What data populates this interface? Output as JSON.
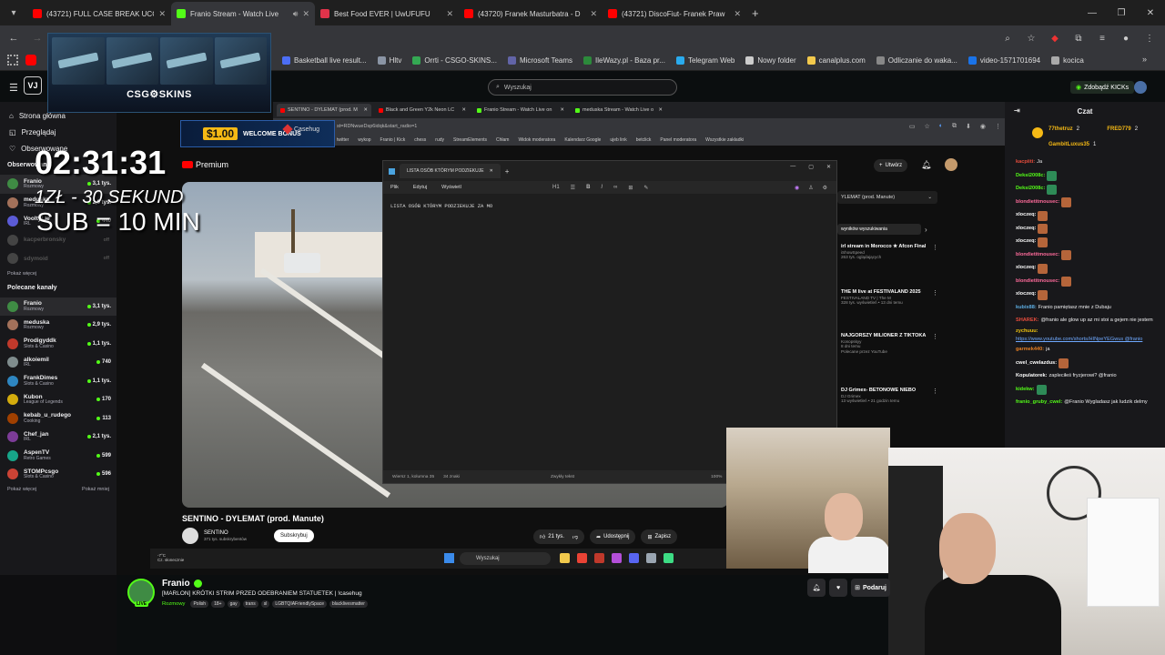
{
  "browser": {
    "tabs": [
      {
        "label": "(43721) FULL CASE BREAK UCCO",
        "icon": "youtube-icon",
        "color": "#ff0000",
        "active": false
      },
      {
        "label": "Franio Stream - Watch Live",
        "icon": "kick-icon",
        "color": "#53fc18",
        "active": true
      },
      {
        "label": "Best Food EVER | UwUFUFU",
        "icon": "uwufufu-icon",
        "color": "#e0334a",
        "active": false
      },
      {
        "label": "(43720) Franek Masturbatra - D",
        "icon": "youtube-icon",
        "color": "#ff0000",
        "active": false
      },
      {
        "label": "(43721) DiscoFiut- Franek Praw",
        "icon": "youtube-icon",
        "color": "#ff0000",
        "active": false
      }
    ],
    "bookmarks": [
      {
        "label": "Basketball live result...",
        "color": "#4c6ef5"
      },
      {
        "label": "Hltv",
        "color": "#8b95a5"
      },
      {
        "label": "Orrti - CSGO-SKINS...",
        "color": "#34a853"
      },
      {
        "label": "Microsoft Teams",
        "color": "#6264a7"
      },
      {
        "label": "IleWazy.pl - Baza pr...",
        "color": "#2c8a3b"
      },
      {
        "label": "Telegram Web",
        "color": "#2aabee"
      },
      {
        "label": "Nowy folder",
        "color": "#cccccc"
      },
      {
        "label": "canalplus.com",
        "color": "#f2c94c"
      },
      {
        "label": "Odliczanie do waka...",
        "color": "#888888"
      },
      {
        "label": "video-1571701694",
        "color": "#1a73e8"
      },
      {
        "label": "kocica",
        "color": "#aaaaaa"
      }
    ]
  },
  "kick": {
    "search_placeholder": "Wyszukaj",
    "get_kicks": "Zdobądź KICKs",
    "logo_text": "VJ"
  },
  "sidebar": {
    "nav": [
      "Strona główna",
      "Przeglądaj",
      "Obserwowane"
    ],
    "followed_header": "Obserwowane",
    "followed": [
      {
        "name": "Franio",
        "cat": "Rozmowy",
        "viewers": "3,1 tys.",
        "color": "#3f8b44",
        "selected": true,
        "dim": false
      },
      {
        "name": "meduska",
        "cat": "Rozmowy",
        "viewers": "2,9 tys.",
        "color": "#a3715a",
        "selected": false,
        "dim": false
      },
      {
        "name": "VooltyLie",
        "cat": "IRL",
        "viewers": "440",
        "color": "#5b5bd6",
        "selected": false,
        "dim": false
      },
      {
        "name": "kacperbronsky",
        "cat": "",
        "viewers": "",
        "color": "#444444",
        "selected": false,
        "dim": true
      },
      {
        "name": "sdymoid",
        "cat": "",
        "viewers": "",
        "color": "#444444",
        "selected": false,
        "dim": true
      }
    ],
    "show_more": "Pokaż więcej",
    "recommended_header": "Polecane kanały",
    "recommended": [
      {
        "name": "Franio",
        "cat": "Rozmowy",
        "viewers": "3,1 tys.",
        "color": "#3f8b44",
        "selected": true
      },
      {
        "name": "meduska",
        "cat": "Rozmowy",
        "viewers": "2,9 tys.",
        "color": "#a3715a",
        "selected": false
      },
      {
        "name": "Prodigyddk",
        "cat": "Slots & Casino",
        "viewers": "1,1 tys.",
        "color": "#c0392b",
        "selected": false
      },
      {
        "name": "alkoiemil",
        "cat": "IRL",
        "viewers": "740",
        "color": "#7f8c8d",
        "selected": false
      },
      {
        "name": "FrankDimes",
        "cat": "Slots & Casino",
        "viewers": "1,1 tys.",
        "color": "#2e86c1",
        "selected": false
      },
      {
        "name": "Kubon",
        "cat": "League of Legends",
        "viewers": "170",
        "color": "#d4ac0d",
        "selected": false
      },
      {
        "name": "kebab_u_rudego",
        "cat": "Cooking",
        "viewers": "113",
        "color": "#a04000",
        "selected": false
      },
      {
        "name": "Chef_jan",
        "cat": "IRL",
        "viewers": "2,1 tys.",
        "color": "#7d3c98",
        "selected": false
      },
      {
        "name": "AspenTV",
        "cat": "Retro Games",
        "viewers": "599",
        "color": "#17a589",
        "selected": false
      },
      {
        "name": "STOMPcsgo",
        "cat": "Slots & Casino",
        "viewers": "596",
        "color": "#cb4335",
        "selected": false
      }
    ],
    "show_more2": "Pokaż więcej",
    "show_less": "Pokaż mniej"
  },
  "overlay": {
    "csgo_logo": "CSG⚙SKINS",
    "timer": "02:31:31",
    "rate_line": "1ZŁ - 30 SEKUND",
    "sub_line": "SUB = 10 MIN",
    "welcome_amount": "$1.00",
    "welcome_text": "WELCOME BONUS",
    "casehug": "Casehug"
  },
  "inner_browser": {
    "tabs": [
      "SENTINO - DYLEMAT (prod. M",
      "Black and Green Y2k Neon LC",
      "Franio Stream - Watch Live on",
      "meduska Stream - Watch Live o"
    ],
    "url": "st=RDNwueDsp6idqk&start_radio=1",
    "bookmarks": [
      "twitter",
      "wykop",
      "Franio | Kick",
      "chess",
      "rudy",
      "StreamElements",
      "Chłam",
      "Widok moderatora",
      "Kalendarz Google",
      "ujeb link",
      "betclick",
      "Panel moderatora",
      "Wszystkie zakładki"
    ]
  },
  "youtube": {
    "premium": "Premium",
    "create": "Utwórz",
    "video_title": "SENTINO - DYLEMAT (prod. Manute)",
    "channel": "SENTINO",
    "subs": "371 tys. subskrybentów",
    "subscribe": "Subskrybuj",
    "likes": "21 tys.",
    "share": "Udostępnij",
    "save": "Zapisz",
    "side_dropdown": "YLEMAT (prod. Manute)",
    "side_head": "wyników wyszukiwania",
    "side_videos": [
      {
        "title": "irl stream in Morocco ★ Afcon Final",
        "sub": "263 tys. oglądających",
        "ch": "iShowSpeed"
      },
      {
        "title": "THE M live at FESTIVALAND 2025",
        "sub": "328 tys. wyświetleń • 13 dni temu",
        "ch": "FESTIVALAND TV | The M"
      },
      {
        "title": "NAJGORSZY MILIONER Z TIKTOKA",
        "sub": "8 dni temu",
        "ch": "Konopskyy"
      },
      {
        "title": "DJ Grimex- BETONOWE NIEBO",
        "sub": "13 wyświetleń • 21 godzin temu",
        "ch": "DJ Grimex"
      }
    ],
    "recommended_by": "Polecane przez YouTube"
  },
  "notepad": {
    "tab_title": "LISTA OSÓB KTÓRYM PODZIEKUJE",
    "menu": [
      "Plik",
      "Edytuj",
      "Wyświetl"
    ],
    "heading_tool": "H1",
    "text": "LISTA OSÓB KTÓRYM PODZIEKUJE ZA MO",
    "status_pos": "Wiersz 1, kolumna 35",
    "status_chars": "34 znaki",
    "status_format": "Zwykły tekst",
    "status_zoom": "100%",
    "status_eol": "Windo"
  },
  "taskbar": {
    "weather_temp": "-7°C",
    "weather_desc": "Cz. słonecznie",
    "search": "Wyszukaj",
    "icons": [
      "#f2c94c",
      "#ea4335",
      "#c0392b",
      "#b44fd8",
      "#5865f2",
      "#9aa5b1",
      "#3ddc84"
    ]
  },
  "stream_info": {
    "name": "Franio",
    "live": "LIVE",
    "title": "[MARLON] KRÓTKI STRIM PRZED ODEBRANIEM STATUETEK | !casehug",
    "category": "Rozmowy",
    "tags": [
      "Polish",
      "18+",
      "gay",
      "trans",
      "sl",
      "LGBTQIAFriendlySpace",
      "blacklivesmatter"
    ],
    "subscribe": "Podaruj"
  },
  "chat": {
    "header": "Czat",
    "pinned": [
      {
        "name": "77thetruz",
        "count": "2"
      },
      {
        "name": "FRED779",
        "count": "2"
      },
      {
        "name": "GambitLuxus35",
        "count": "1"
      }
    ],
    "messages": [
      {
        "user": "kacpiiti:",
        "color": "#e74c3c",
        "text": "Ja",
        "emote": ""
      },
      {
        "user": "Deksi2008c:",
        "color": "#53fc18",
        "text": "",
        "emote": "#2e8b57"
      },
      {
        "user": "Deksi2008c:",
        "color": "#53fc18",
        "text": "",
        "emote": "#2e8b57"
      },
      {
        "user": "blondietitmousec:",
        "color": "#ff6b9b",
        "text": "",
        "emote": "#b5653a"
      },
      {
        "user": "xloczeq:",
        "color": "#ffffff",
        "text": "",
        "emote": "#b5653a"
      },
      {
        "user": "xloczeq:",
        "color": "#ffffff",
        "text": "",
        "emote": "#b5653a"
      },
      {
        "user": "xloczeq:",
        "color": "#ffffff",
        "text": "",
        "emote": "#b5653a"
      },
      {
        "user": "blondietitmousec:",
        "color": "#ff6b9b",
        "text": "",
        "emote": "#b5653a"
      },
      {
        "user": "xloczeq:",
        "color": "#ffffff",
        "text": "",
        "emote": "#b5653a"
      },
      {
        "user": "blondietitmousec:",
        "color": "#ff6b9b",
        "text": "",
        "emote": "#b5653a"
      },
      {
        "user": "xloczeq:",
        "color": "#ffffff",
        "text": "",
        "emote": "#b5653a"
      },
      {
        "user": "kubix88:",
        "color": "#5dade2",
        "text": "Franio pamiętasz mnie z Dubaju",
        "emote": ""
      },
      {
        "user": "SHAREK:",
        "color": "#e74c3c",
        "text": "@franio ale glow up az mi stoi a gejem nie jestem",
        "emote": ""
      },
      {
        "user": "zychuuu:",
        "color": "#f1c40f",
        "text": "https://www.youtube.com/shorts/HINpeYEGwus @franio",
        "emote": ""
      },
      {
        "user": "garmek440:",
        "color": "#e67e22",
        "text": "ja",
        "emote": ""
      },
      {
        "user": "cwel_cwelazdus:",
        "color": "#ffffff",
        "text": "",
        "emote": "#b5653a"
      },
      {
        "user": "Kopulatorek:",
        "color": "#ffffff",
        "text": "zapleciłeś fryzjerowi? @franio",
        "emote": ""
      },
      {
        "user": "kidekw:",
        "color": "#53fc18",
        "text": "",
        "emote": "#2e8b57"
      },
      {
        "user": "franio_gruby_cwel:",
        "color": "#53fc18",
        "text": "@Franio Wygladasz jak ludzik delmy",
        "emote": ""
      }
    ]
  }
}
